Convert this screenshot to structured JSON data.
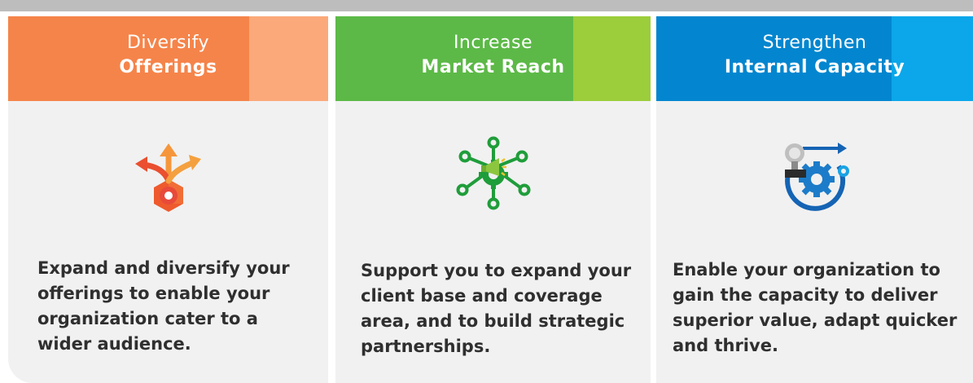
{
  "colors": {
    "top_bar": "#bdbdbd",
    "panel_bg": "#f1f1f1",
    "orange": "#f5844a",
    "orange_light": "#fba97a",
    "green": "#5cb947",
    "green_light": "#9ccd3b",
    "blue": "#0386cf",
    "blue_light": "#0ba7ea",
    "text_dark": "#2f2f2f"
  },
  "cards": [
    {
      "title_line1": "Diversify",
      "title_line2": "Offerings",
      "icon": "diverging-arrows-gear-icon",
      "description": "Expand and diversify your offerings to enable your organization cater to a wider audience."
    },
    {
      "title_line1": "Increase",
      "title_line2": "Market Reach",
      "icon": "megaphone-network-icon",
      "description": "Support you to expand your client base and coverage area, and to build strategic partnerships."
    },
    {
      "title_line1": "Strengthen",
      "title_line2": "Internal Capacity",
      "icon": "gears-lightbulb-growth-icon",
      "description": "Enable your organization to gain the capacity to deliver superior value, adapt quicker and thrive."
    }
  ]
}
